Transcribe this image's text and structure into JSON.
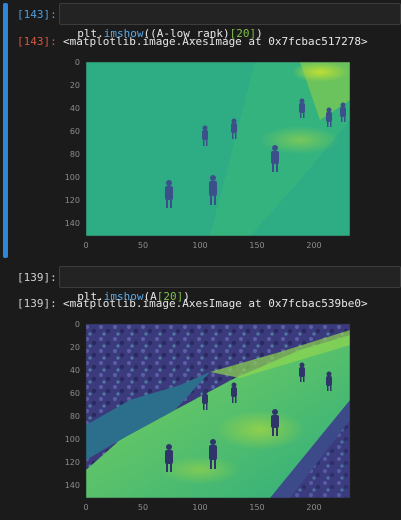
{
  "cells": [
    {
      "in_prompt": "[143]:",
      "code": {
        "prefix": "plt.",
        "fn": "imshow",
        "mid": "((A-low_rank)",
        "num": "[20]",
        "suffix": ")"
      },
      "out_prompt": "[143]:",
      "out_text": "<matplotlib.image.AxesImage at 0x7fcbac517278>",
      "image": {
        "kind": "low-rank-residual",
        "x_ticks": [
          "0",
          "50",
          "100",
          "150",
          "200"
        ],
        "y_ticks": [
          "0",
          "20",
          "40",
          "60",
          "80",
          "100",
          "120",
          "140"
        ],
        "colors": {
          "bg": "#2eac84",
          "dark": "#3b4f8a",
          "light": "#b9de2f"
        }
      }
    },
    {
      "in_prompt": "[139]:",
      "code": {
        "prefix": "plt.",
        "fn": "imshow",
        "mid": "(A",
        "num": "[20]",
        "suffix": ")"
      },
      "out_prompt": "[139]:",
      "out_text": "<matplotlib.image.AxesImage at 0x7fcbac539be0>",
      "image": {
        "kind": "original-frame",
        "x_ticks": [
          "0",
          "50",
          "100",
          "150",
          "200"
        ],
        "y_ticks": [
          "0",
          "20",
          "40",
          "60",
          "80",
          "100",
          "120",
          "140"
        ],
        "colors": {
          "foliage": "#3d3a7e",
          "path": "#63c868",
          "grass": "#2b6f8d",
          "light": "#b8dc35"
        }
      }
    }
  ]
}
